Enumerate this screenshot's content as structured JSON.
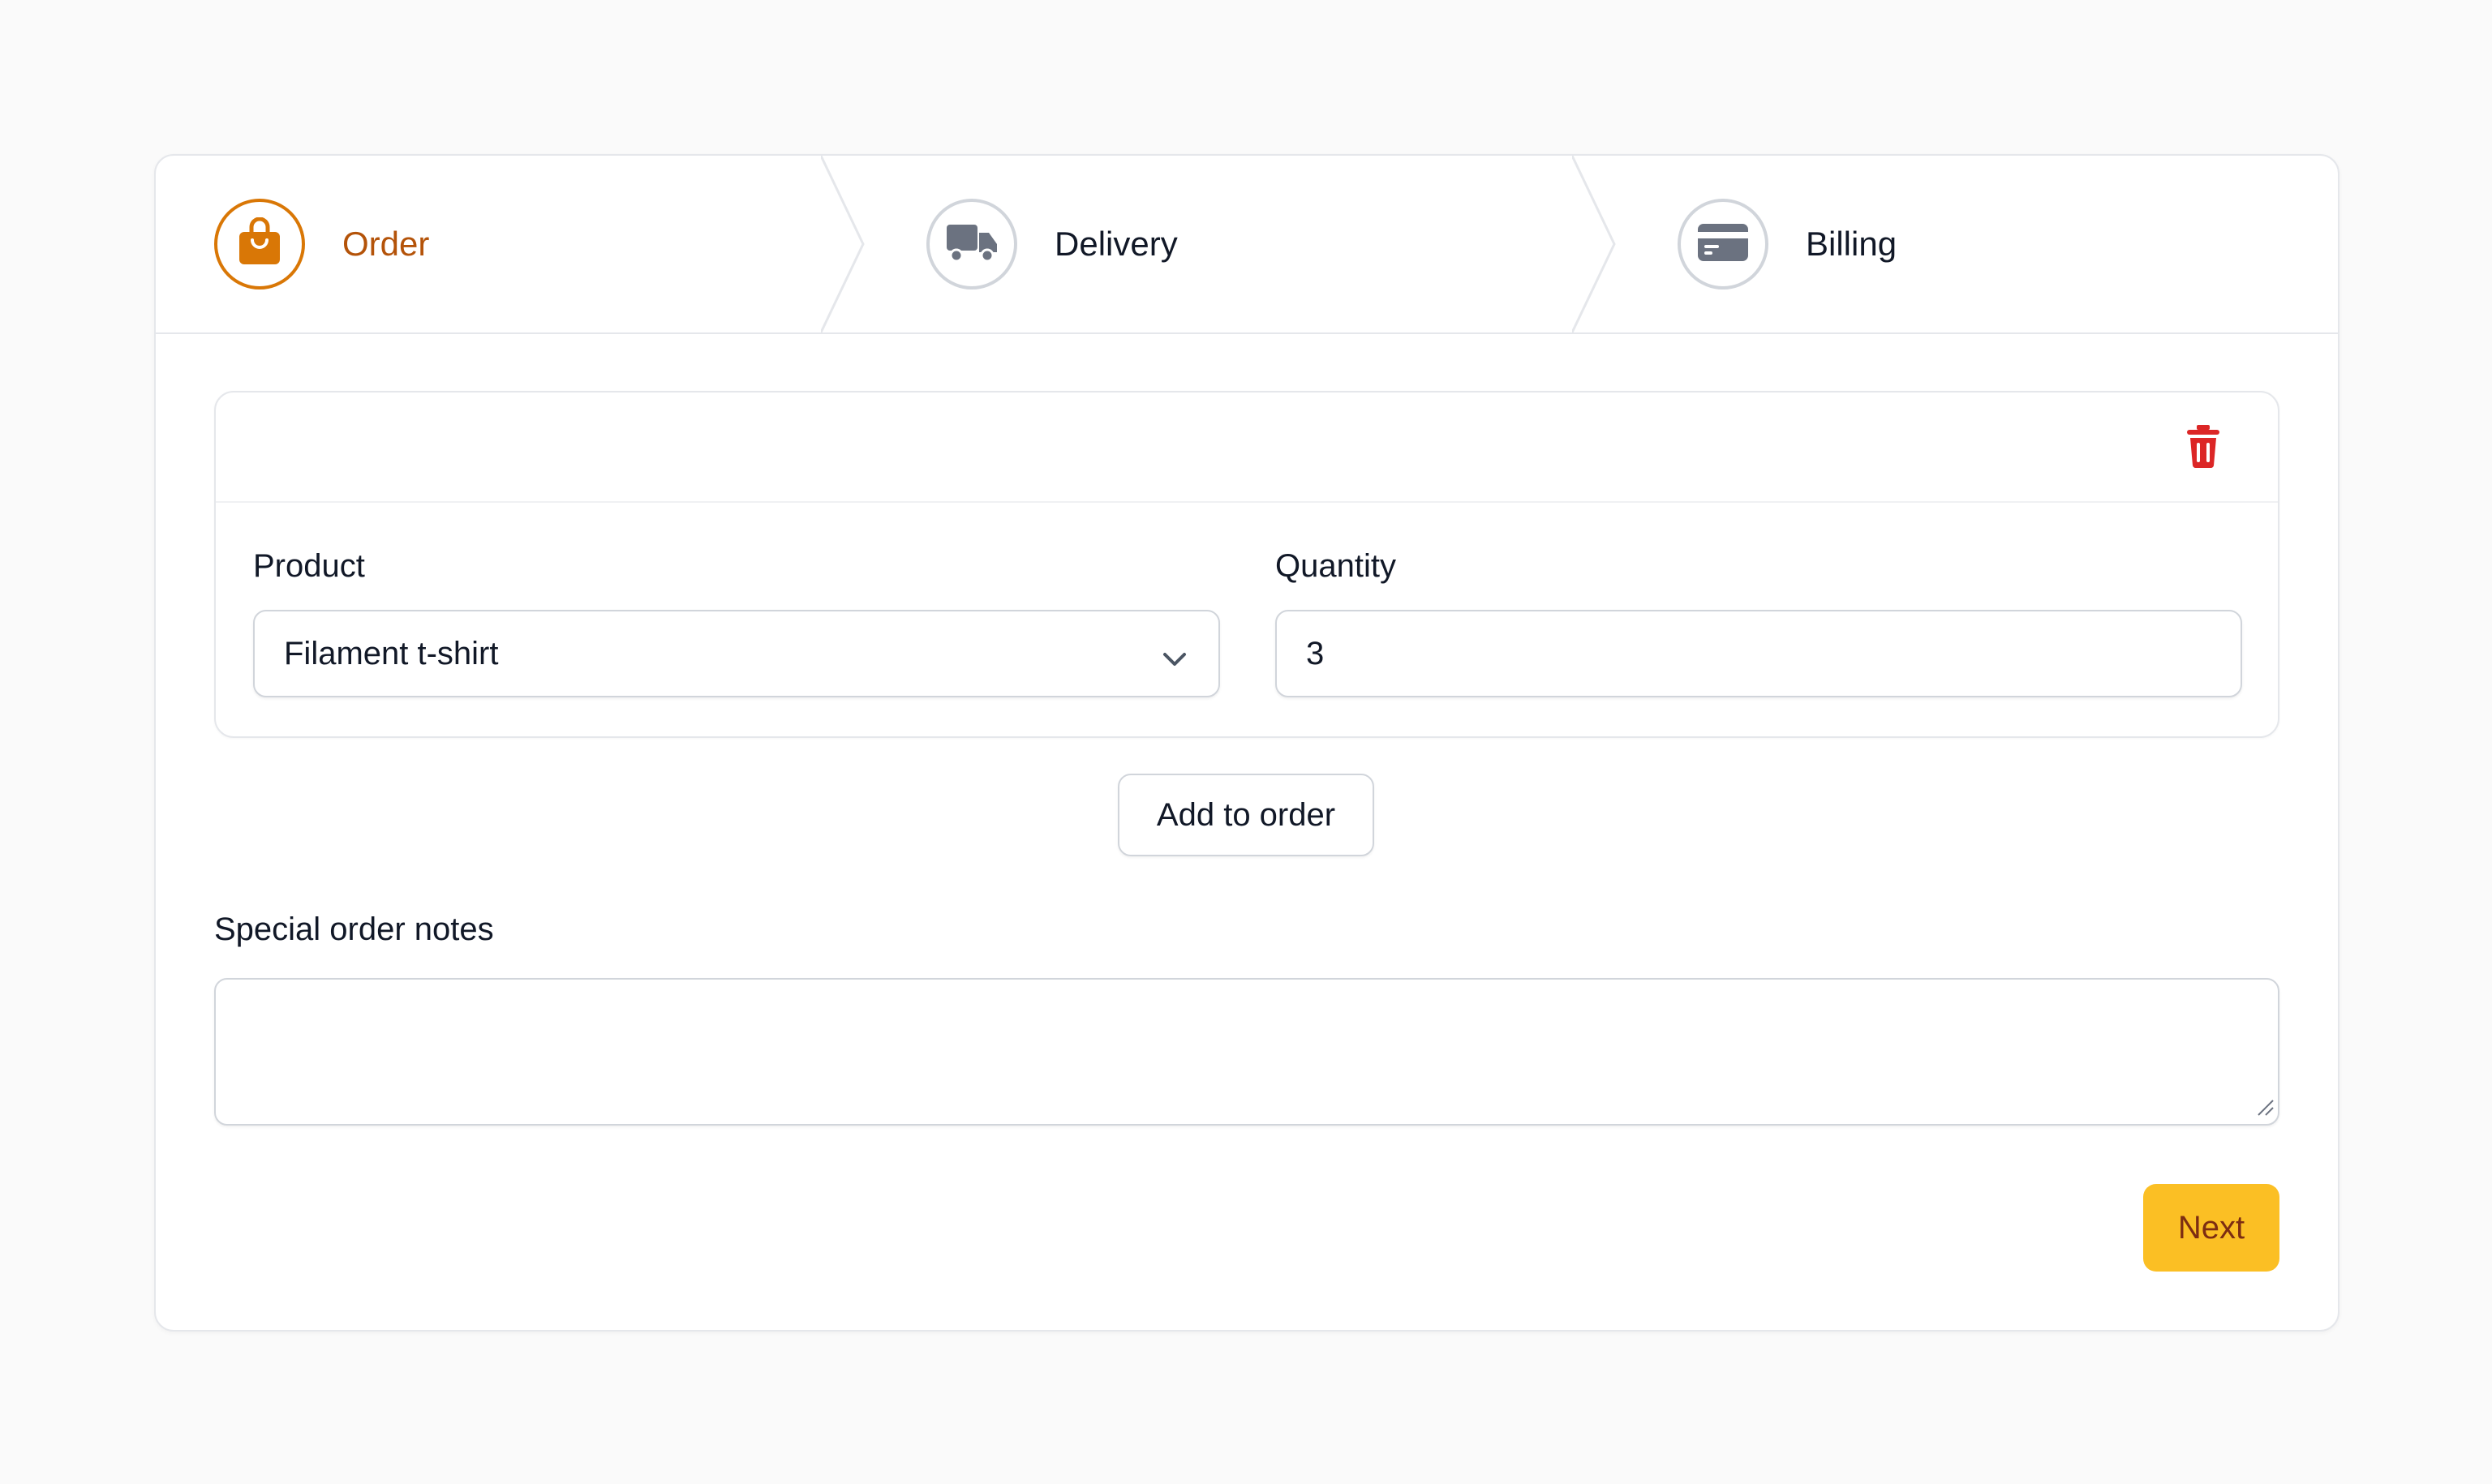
{
  "steps": [
    {
      "label": "Order",
      "icon": "shopping-bag-icon",
      "active": true
    },
    {
      "label": "Delivery",
      "icon": "truck-icon",
      "active": false
    },
    {
      "label": "Billing",
      "icon": "credit-card-icon",
      "active": false
    }
  ],
  "order_item": {
    "product_label": "Product",
    "product_value": "Filament t-shirt",
    "quantity_label": "Quantity",
    "quantity_value": "3"
  },
  "add_button_label": "Add to order",
  "notes": {
    "label": "Special order notes",
    "value": ""
  },
  "next_button_label": "Next",
  "colors": {
    "accent": "#d97706",
    "accent_text": "#b45309",
    "primary_button": "#fbbf24",
    "danger": "#dc2626"
  }
}
